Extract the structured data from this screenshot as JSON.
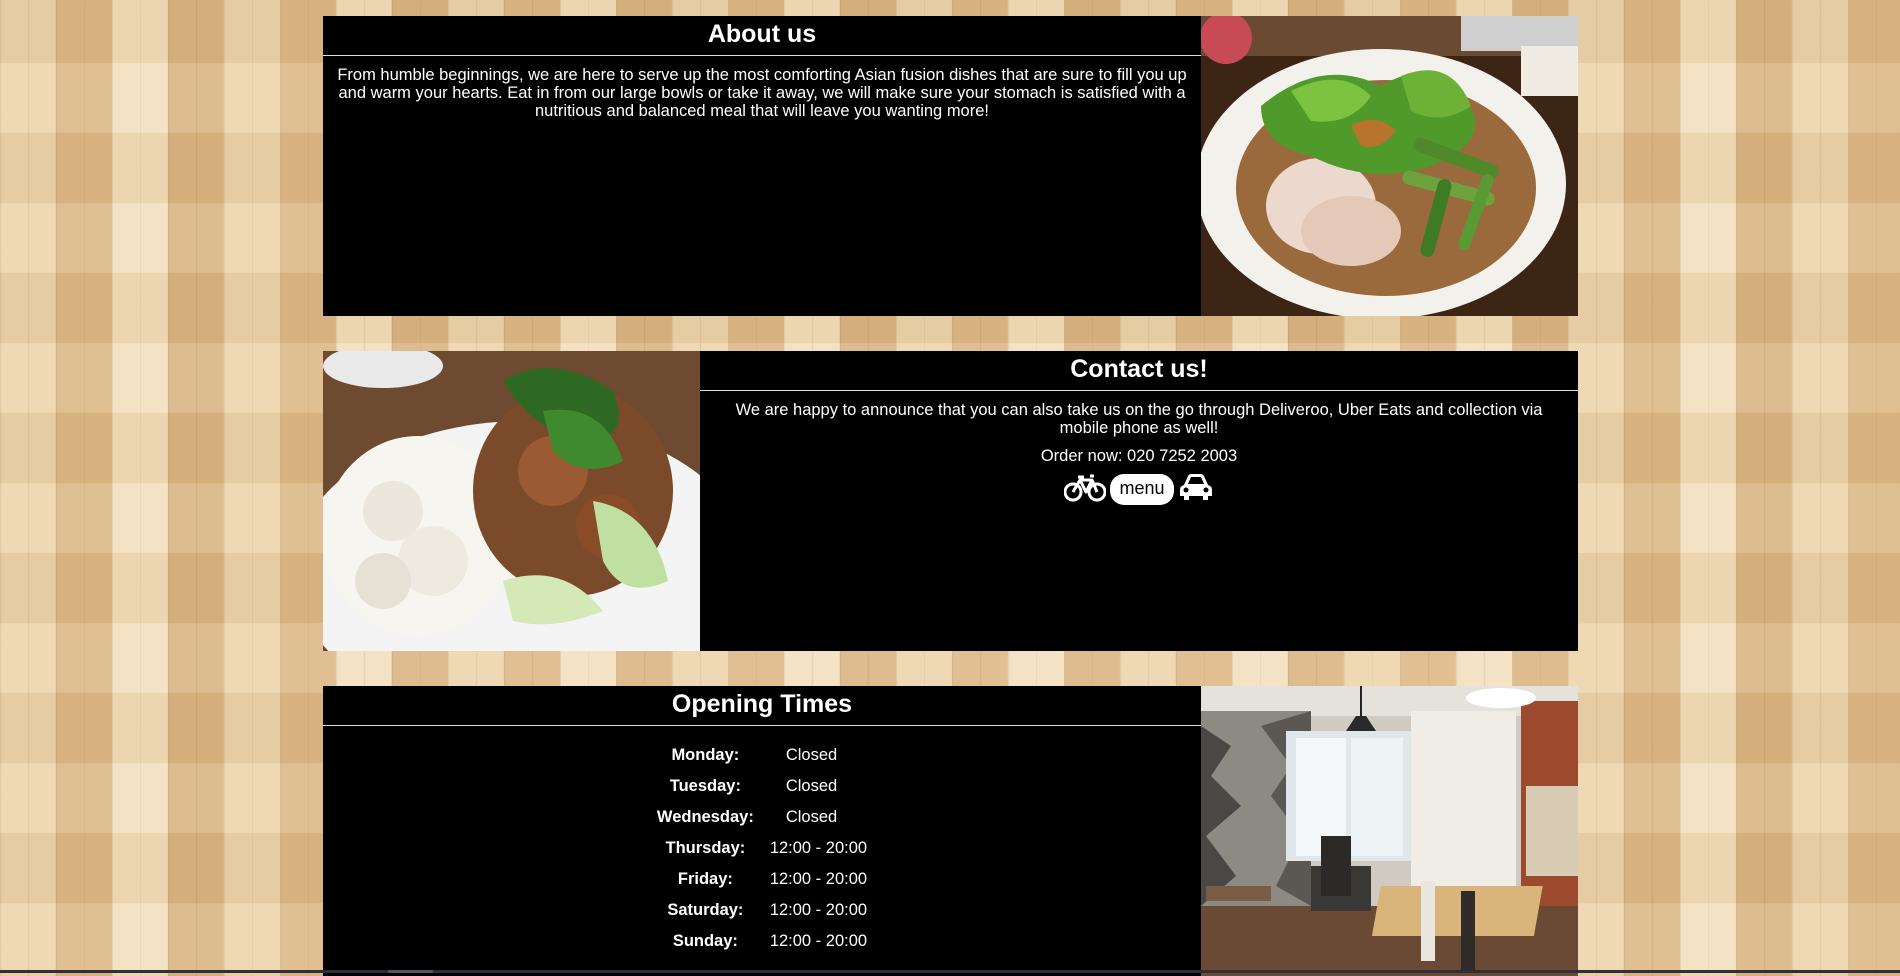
{
  "about": {
    "title": "About us",
    "body": "From humble beginnings, we are here to serve up the most comforting Asian fusion dishes that are sure to fill you up and warm your hearts. Eat in from our large bowls or take it away, we will make sure your stomach is satisfied with a nutritious and balanced meal that will leave you wanting more!",
    "image_icon": "noodle-soup-photo"
  },
  "contact": {
    "title": "Contact us!",
    "body": "We are happy to announce that you can also take us on the go through Deliveroo, Uber Eats and collection via mobile phone as well!",
    "order_label": "Order now: 020 7252 2003",
    "menu_label": "menu",
    "icons": [
      "bicycle-icon",
      "car-icon"
    ],
    "image_icon": "rice-plate-photo"
  },
  "opening": {
    "title": "Opening Times",
    "days": [
      {
        "day": "Monday:",
        "time": "Closed"
      },
      {
        "day": "Tuesday:",
        "time": "Closed"
      },
      {
        "day": "Wednesday:",
        "time": "Closed"
      },
      {
        "day": "Thursday:",
        "time": "12:00 - 20:00"
      },
      {
        "day": "Friday:",
        "time": "12:00 - 20:00"
      },
      {
        "day": "Saturday:",
        "time": "12:00 - 20:00"
      },
      {
        "day": "Sunday:",
        "time": "12:00 - 20:00"
      }
    ],
    "image_icon": "restaurant-interior-photo"
  },
  "colors": {
    "panel": "#000000",
    "text": "#ffffff",
    "wood": "#e3c79c"
  }
}
